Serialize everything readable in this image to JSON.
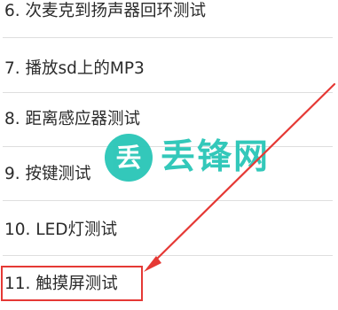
{
  "list": {
    "items": [
      {
        "label": "6. 次麦克到扬声器回环测试"
      },
      {
        "label": "7. 播放sd上的MP3"
      },
      {
        "label": "8. 距离感应器测试"
      },
      {
        "label": "9. 按键测试"
      },
      {
        "label": "10. LED灯测试"
      },
      {
        "label": "11. 触摸屏测试"
      }
    ],
    "highlighted_index": 5
  },
  "watermark": {
    "icon_text": "丢",
    "text": "丢锋网"
  },
  "colors": {
    "highlight": "#e53935",
    "watermark": "#29c6b7",
    "text": "#2b2b2b",
    "divider": "#dedede"
  }
}
